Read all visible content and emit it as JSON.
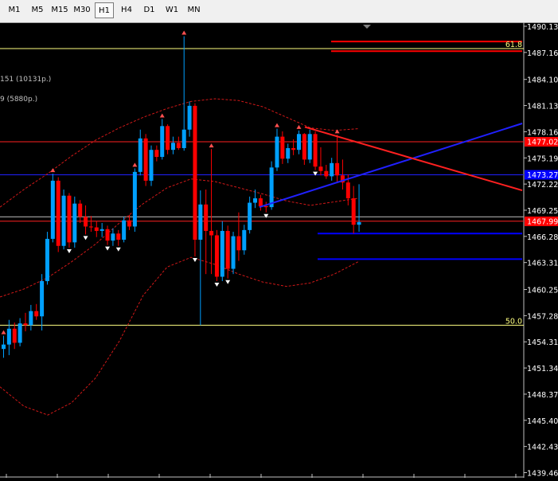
{
  "toolbar": {
    "timeframes": [
      {
        "label": "M1",
        "active": false
      },
      {
        "label": "M5",
        "active": false
      },
      {
        "label": "M15",
        "active": false
      },
      {
        "label": "M30",
        "active": false
      },
      {
        "label": "H1",
        "active": true
      },
      {
        "label": "H4",
        "active": false
      },
      {
        "label": "D1",
        "active": false
      },
      {
        "label": "W1",
        "active": false
      },
      {
        "label": "MN",
        "active": false
      }
    ]
  },
  "chart_data": {
    "type": "candlestick",
    "ylim": [
      1439.25,
      1491.6
    ],
    "y_ticks": [
      "1490.130",
      "1487.160",
      "1484.100",
      "1481.130",
      "1478.160",
      "1475.190",
      "1472.220",
      "1469.250",
      "1466.280",
      "1463.310",
      "1460.250",
      "1457.280",
      "1454.310",
      "1451.340",
      "1448.370",
      "1445.400",
      "1442.430",
      "1439.460"
    ],
    "price_labels": [
      {
        "text": "1477.020",
        "price": 1477.02,
        "color": "#ff0000"
      },
      {
        "text": "1473.270",
        "price": 1473.27,
        "color": "#0000ff"
      },
      {
        "text": "1467.994",
        "price": 1467.99,
        "color": "#ff0000"
      }
    ],
    "partial_labels": [
      "151 (10131p.)",
      "9 (5880p.)"
    ],
    "fib_levels": [
      {
        "label": "61.8",
        "price": 1487.6
      },
      {
        "label": "50.0",
        "price": 1456.2
      }
    ],
    "colors": {
      "bull": "#00a0ff",
      "bear": "#ff0000",
      "fib": "#ffff80",
      "axis_bg": "#000000",
      "axis_text": "#ffffff"
    },
    "candles": [
      [
        1453.5,
        1455.0,
        1452.5,
        1454.0
      ],
      [
        1454.0,
        1456.8,
        1452.8,
        1455.8
      ],
      [
        1455.8,
        1456.5,
        1453.5,
        1454.2
      ],
      [
        1454.2,
        1457.0,
        1453.8,
        1456.4
      ],
      [
        1456.4,
        1457.6,
        1455.5,
        1456.2
      ],
      [
        1456.2,
        1458.5,
        1455.6,
        1457.8
      ],
      [
        1457.8,
        1458.6,
        1456.8,
        1457.2
      ],
      [
        1457.2,
        1462.0,
        1455.6,
        1461.2
      ],
      [
        1461.2,
        1466.8,
        1460.8,
        1466.0
      ],
      [
        1466.0,
        1473.4,
        1465.6,
        1472.6
      ],
      [
        1472.6,
        1473.0,
        1464.5,
        1465.2
      ],
      [
        1465.2,
        1471.6,
        1464.8,
        1470.9
      ],
      [
        1470.9,
        1471.2,
        1465.0,
        1465.6
      ],
      [
        1465.6,
        1470.8,
        1465.0,
        1470.0
      ],
      [
        1470.0,
        1470.4,
        1467.8,
        1468.5
      ],
      [
        1468.5,
        1469.8,
        1466.5,
        1467.4
      ],
      [
        1467.4,
        1468.6,
        1466.8,
        1467.3
      ],
      [
        1467.3,
        1468.0,
        1466.2,
        1466.9
      ],
      [
        1466.9,
        1467.8,
        1466.2,
        1467.1
      ],
      [
        1467.1,
        1467.5,
        1465.3,
        1465.8
      ],
      [
        1465.8,
        1467.2,
        1465.2,
        1466.6
      ],
      [
        1466.6,
        1467.0,
        1465.2,
        1465.9
      ],
      [
        1465.9,
        1468.5,
        1465.6,
        1468.1
      ],
      [
        1468.1,
        1468.7,
        1467.0,
        1467.4
      ],
      [
        1467.4,
        1474.0,
        1466.8,
        1473.6
      ],
      [
        1473.6,
        1478.4,
        1473.2,
        1477.4
      ],
      [
        1477.4,
        1477.9,
        1472.0,
        1472.6
      ],
      [
        1472.6,
        1476.6,
        1472.0,
        1476.1
      ],
      [
        1476.1,
        1476.6,
        1474.8,
        1475.3
      ],
      [
        1475.3,
        1479.6,
        1475.0,
        1478.8
      ],
      [
        1478.8,
        1479.0,
        1475.6,
        1476.1
      ],
      [
        1476.1,
        1477.6,
        1475.6,
        1476.9
      ],
      [
        1476.9,
        1477.6,
        1476.1,
        1476.3
      ],
      [
        1476.3,
        1489.0,
        1476.0,
        1478.4
      ],
      [
        1478.4,
        1481.6,
        1477.6,
        1481.1
      ],
      [
        1481.1,
        1481.4,
        1464.0,
        1465.9
      ],
      [
        1465.9,
        1471.5,
        1456.2,
        1469.9
      ],
      [
        1469.9,
        1471.6,
        1462.0,
        1466.9
      ],
      [
        1466.9,
        1476.2,
        1462.0,
        1466.4
      ],
      [
        1466.4,
        1467.0,
        1461.2,
        1461.7
      ],
      [
        1461.7,
        1468.0,
        1461.2,
        1466.9
      ],
      [
        1466.9,
        1467.5,
        1461.5,
        1462.6
      ],
      [
        1462.6,
        1466.8,
        1462.0,
        1466.3
      ],
      [
        1466.3,
        1469.0,
        1463.5,
        1464.7
      ],
      [
        1464.7,
        1467.6,
        1464.2,
        1467.0
      ],
      [
        1467.0,
        1470.8,
        1466.6,
        1470.1
      ],
      [
        1470.1,
        1471.6,
        1469.5,
        1470.6
      ],
      [
        1470.6,
        1471.0,
        1469.2,
        1469.7
      ],
      [
        1469.7,
        1470.2,
        1469.0,
        1469.6
      ],
      [
        1469.6,
        1474.8,
        1469.3,
        1474.1
      ],
      [
        1474.1,
        1478.5,
        1473.7,
        1477.6
      ],
      [
        1477.6,
        1478.2,
        1474.5,
        1475.1
      ],
      [
        1475.1,
        1476.8,
        1474.6,
        1476.3
      ],
      [
        1476.3,
        1477.3,
        1475.5,
        1476.1
      ],
      [
        1476.1,
        1478.3,
        1475.6,
        1477.9
      ],
      [
        1477.9,
        1478.0,
        1474.4,
        1475.0
      ],
      [
        1475.0,
        1478.4,
        1474.6,
        1477.9
      ],
      [
        1477.9,
        1478.2,
        1473.8,
        1474.2
      ],
      [
        1474.2,
        1476.4,
        1473.2,
        1473.7
      ],
      [
        1473.7,
        1474.4,
        1472.8,
        1473.1
      ],
      [
        1473.1,
        1475.2,
        1472.6,
        1474.6
      ],
      [
        1474.6,
        1477.8,
        1472.4,
        1473.2
      ],
      [
        1473.2,
        1475.0,
        1471.6,
        1472.4
      ],
      [
        1472.4,
        1473.3,
        1469.8,
        1470.6
      ],
      [
        1470.6,
        1472.0,
        1466.6,
        1467.6
      ],
      [
        1467.6,
        1472.2,
        1466.8,
        1467.9
      ]
    ],
    "bands": {
      "upper": [
        1469.6,
        1471.6,
        1473.4,
        1475.4,
        1477.2,
        1478.6,
        1479.8,
        1480.8,
        1481.6,
        1481.9,
        1481.7,
        1481.0,
        1479.8,
        1478.6,
        1478.3,
        1478.5
      ],
      "middle": [
        1459.4,
        1460.3,
        1461.6,
        1463.4,
        1465.4,
        1467.8,
        1470.0,
        1471.8,
        1472.8,
        1472.5,
        1471.8,
        1471.1,
        1470.3,
        1469.8,
        1470.2,
        1470.6
      ],
      "lower": [
        1449.2,
        1447.0,
        1446.0,
        1447.4,
        1450.2,
        1454.4,
        1459.6,
        1462.8,
        1463.9,
        1463.1,
        1462.0,
        1461.1,
        1460.6,
        1461.0,
        1462.0,
        1463.4
      ]
    }
  }
}
